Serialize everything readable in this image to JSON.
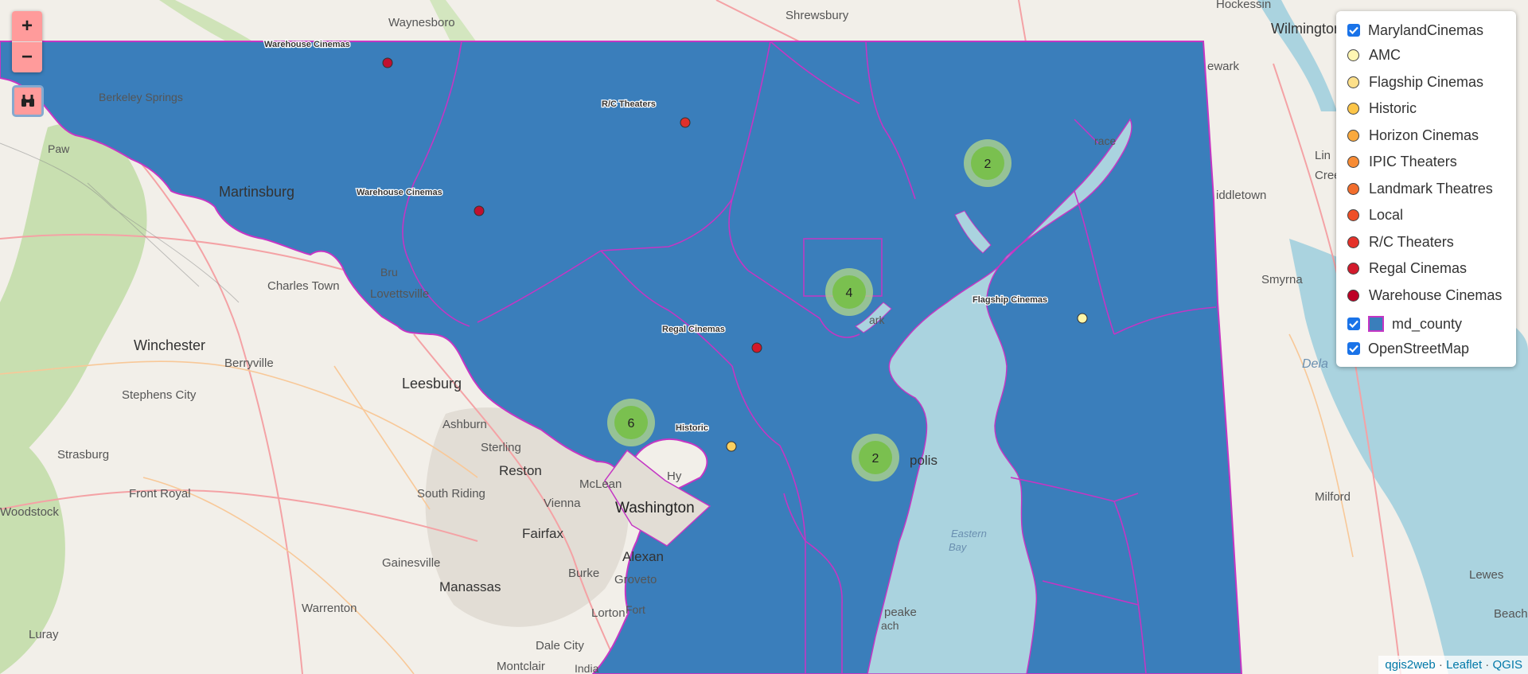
{
  "map_labels": {
    "waynesboro": "Waynesboro",
    "shrewsbury": "Shrewsbury",
    "hockessin": "Hockessin",
    "wilmington": "Wilmington",
    "newark": "ewark",
    "berkeley_springs": "Berkeley Springs",
    "paw": "Paw",
    "martinsburg": "Martinsburg",
    "charles_town": "Charles Town",
    "lovettsville": "Lovettsville",
    "brunswick": "Bru",
    "winchester": "Winchester",
    "berryville": "Berryville",
    "leesburg": "Leesburg",
    "stephens_city": "Stephens City",
    "ashburn": "Ashburn",
    "sterling": "Sterling",
    "reston": "Reston",
    "strasburg": "Strasburg",
    "front_royal": "Front Royal",
    "south_riding": "South Riding",
    "mclean": "McLean",
    "vienna": "Vienna",
    "washington": "Washington",
    "fairfax": "Fairfax",
    "woodstock": "Woodstock",
    "gainesville": "Gainesville",
    "burke": "Burke",
    "alexandria": "Alexan",
    "groveton": "Groveto",
    "manassas": "Manassas",
    "warrenton": "Warrenton",
    "lorton": "Lorton",
    "fort": "Fort",
    "luray": "Luray",
    "dale_city": "Dale City",
    "montclair": "Montclair",
    "india": "India",
    "middletown": "iddletown",
    "smyrna": "Smyrna",
    "milford": "Milford",
    "lewes": "Lewes",
    "beach": "Beach",
    "dela": "Dela",
    "creek": "Cree",
    "lin": "Lin",
    "annapolis": "polis",
    "park": "ark",
    "chesapeake": "peake",
    "ach": "ach",
    "eastern_bay": "Eastern",
    "bay": "Bay",
    "hy": "Hy",
    "grace": "race"
  },
  "points": [
    {
      "label": "Warehouse Cinemas",
      "layer": "Warehouse Cinemas",
      "color": "#c0102f"
    },
    {
      "label": "R/C Theaters",
      "layer": "R/C Theaters",
      "color": "#e0302a"
    },
    {
      "label": "Warehouse Cinemas",
      "layer": "Warehouse Cinemas",
      "color": "#c0102f"
    },
    {
      "label": "Flagship Cinemas",
      "layer": "AMC",
      "color": "#fff6a8"
    },
    {
      "label": "Regal Cinemas",
      "layer": "Regal Cinemas",
      "color": "#d4182a"
    },
    {
      "label": "Historic",
      "layer": "Historic",
      "color": "#fcd060"
    }
  ],
  "clusters": [
    {
      "count": "2"
    },
    {
      "count": "4"
    },
    {
      "count": "6"
    },
    {
      "count": "2"
    }
  ],
  "controls": {
    "zoom_in": "+",
    "zoom_out": "−"
  },
  "legend": {
    "group": {
      "label": "MarylandCinemas",
      "checked": true
    },
    "items": [
      {
        "label": "AMC",
        "color": "#fff6b3"
      },
      {
        "label": "Flagship Cinemas",
        "color": "#fde08a"
      },
      {
        "label": "Historic",
        "color": "#fcc548"
      },
      {
        "label": "Horizon Cinemas",
        "color": "#f9a93e"
      },
      {
        "label": "IPIC Theaters",
        "color": "#f78b34"
      },
      {
        "label": "Landmark Theatres",
        "color": "#f26d2c"
      },
      {
        "label": "Local",
        "color": "#ee4f28"
      },
      {
        "label": "R/C Theaters",
        "color": "#e5322a"
      },
      {
        "label": "Regal Cinemas",
        "color": "#d31a2c"
      },
      {
        "label": "Warehouse Cinemas",
        "color": "#bd0026"
      }
    ],
    "county": {
      "label": "md_county",
      "checked": true
    },
    "basemap": {
      "label": "OpenStreetMap",
      "checked": true
    }
  },
  "attribution": {
    "qgis2web": "qgis2web",
    "sep1": " · ",
    "leaflet": "Leaflet",
    "sep2": " · ",
    "qgis": "QGIS"
  },
  "colors": {
    "county_fill": "#3a7ebb",
    "county_border": "#c436c4",
    "water": "#aad3df",
    "land": "#f2efe9",
    "cluster": "#7ac04f"
  }
}
